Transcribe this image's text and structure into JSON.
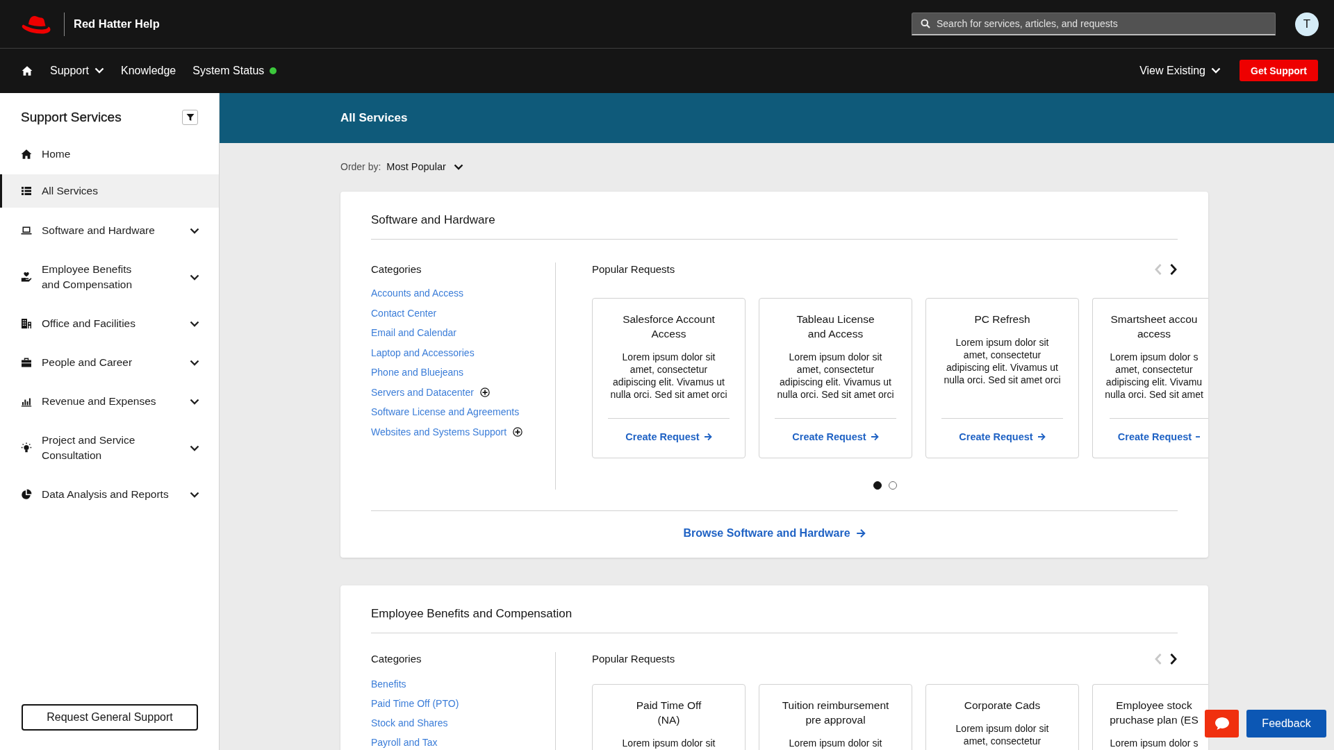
{
  "header": {
    "brand": "Red Hatter Help",
    "search": {
      "placeholder": "Search for services, articles, and requests"
    },
    "avatar": "T"
  },
  "nav": {
    "items": [
      {
        "label": "Support",
        "kind": "menu",
        "expanded": false
      },
      {
        "label": "Knowledge",
        "kind": "link"
      },
      {
        "label": "System Status",
        "kind": "status",
        "color": "#3cc83c"
      }
    ],
    "view_existing": {
      "label": "View Existing",
      "expanded": false
    },
    "get_support": "Get Support"
  },
  "sidebar": {
    "title": "Support Services",
    "items": [
      {
        "label": "Home",
        "kind": "link",
        "selected": false
      },
      {
        "label": "All Services",
        "kind": "link",
        "selected": true
      },
      {
        "label": "Software and Hardware",
        "kind": "group",
        "selected": false,
        "expanded": false
      },
      {
        "label": "Employee Benefits\nand Compensation",
        "kind": "group",
        "selected": false,
        "expanded": false
      },
      {
        "label": "Office and Facilities",
        "kind": "group",
        "selected": false,
        "expanded": false
      },
      {
        "label": "People and Career",
        "kind": "group",
        "selected": false,
        "expanded": false
      },
      {
        "label": "Revenue and Expenses",
        "kind": "group",
        "selected": false,
        "expanded": false
      },
      {
        "label": "Project and Service\nConsultation",
        "kind": "group",
        "selected": false,
        "expanded": false
      },
      {
        "label": "Data Analysis and Reports",
        "kind": "group",
        "selected": false,
        "expanded": false
      }
    ],
    "button": "Request General Support"
  },
  "main": {
    "title": "All Services",
    "order_by": {
      "label": "Order by:",
      "value": "Most Popular",
      "expanded": false
    },
    "sections": [
      {
        "title": "Software and Hardware",
        "categories_title": "Categories",
        "categories": [
          {
            "label": "Accounts and Access",
            "expandable": false
          },
          {
            "label": "Contact Center",
            "expandable": false
          },
          {
            "label": "Email and Calendar",
            "expandable": false
          },
          {
            "label": "Laptop and Accessories",
            "expandable": false
          },
          {
            "label": "Phone and Bluejeans",
            "expandable": false
          },
          {
            "label": "Servers and Datacenter",
            "expandable": true
          },
          {
            "label": "Software License and Agreements",
            "expandable": false
          },
          {
            "label": "Websites and Systems Support",
            "expandable": true
          }
        ],
        "requests_title": "Popular Requests",
        "prev_disabled": true,
        "next_disabled": false,
        "requests": [
          {
            "kind": "full",
            "title": "Salesforce Account\nAccess",
            "body": "Lorem ipsum dolor sit\namet, consectetur\nadipiscing elit. Vivamus ut\nnulla orci. Sed sit amet orci",
            "action": "Create Request"
          },
          {
            "kind": "full",
            "title": "Tableau License\nand Access",
            "body": "Lorem ipsum dolor sit\namet, consectetur\nadipiscing elit. Vivamus ut\nnulla orci. Sed sit amet orci",
            "action": "Create Request"
          },
          {
            "kind": "full",
            "title": "PC Refresh",
            "body": "Lorem ipsum dolor sit\namet, consectetur\nadipiscing elit. Vivamus ut\nnulla orci. Sed sit amet orci",
            "action": "Create Request"
          },
          {
            "kind": "partial",
            "title": "Smartsheet accou\naccess",
            "body": "Lorem ipsum dolor s\namet, consectetur\nadipiscing elit. Vivamu\nnulla orci. Sed sit amet",
            "action": "Create Request"
          }
        ],
        "pages": [
          {
            "selected": true
          },
          {
            "selected": false
          }
        ],
        "browse": "Browse Software and Hardware"
      },
      {
        "title": "Employee Benefits and Compensation",
        "categories_title": "Categories",
        "categories": [
          {
            "label": "Benefits",
            "expandable": false
          },
          {
            "label": "Paid Time Off (PTO)",
            "expandable": false
          },
          {
            "label": "Stock and Shares",
            "expandable": false
          },
          {
            "label": "Payroll and Tax",
            "expandable": false
          }
        ],
        "requests_title": "Popular Requests",
        "prev_disabled": true,
        "next_disabled": false,
        "requests": [
          {
            "kind": "full",
            "title": "Paid Time Off\n(NA)",
            "body": "Lorem ipsum dolor sit"
          },
          {
            "kind": "full",
            "title": "Tuition reimbursement\npre approval",
            "body": "Lorem ipsum dolor sit"
          },
          {
            "kind": "full",
            "title": "Corporate Cads",
            "body": "Lorem ipsum dolor sit\namet, consectetur"
          },
          {
            "kind": "partial",
            "title": "Employee stock\npruchase plan (ES",
            "body": "Lorem ipsum dolor s"
          }
        ]
      }
    ]
  },
  "feedback": "Feedback"
}
